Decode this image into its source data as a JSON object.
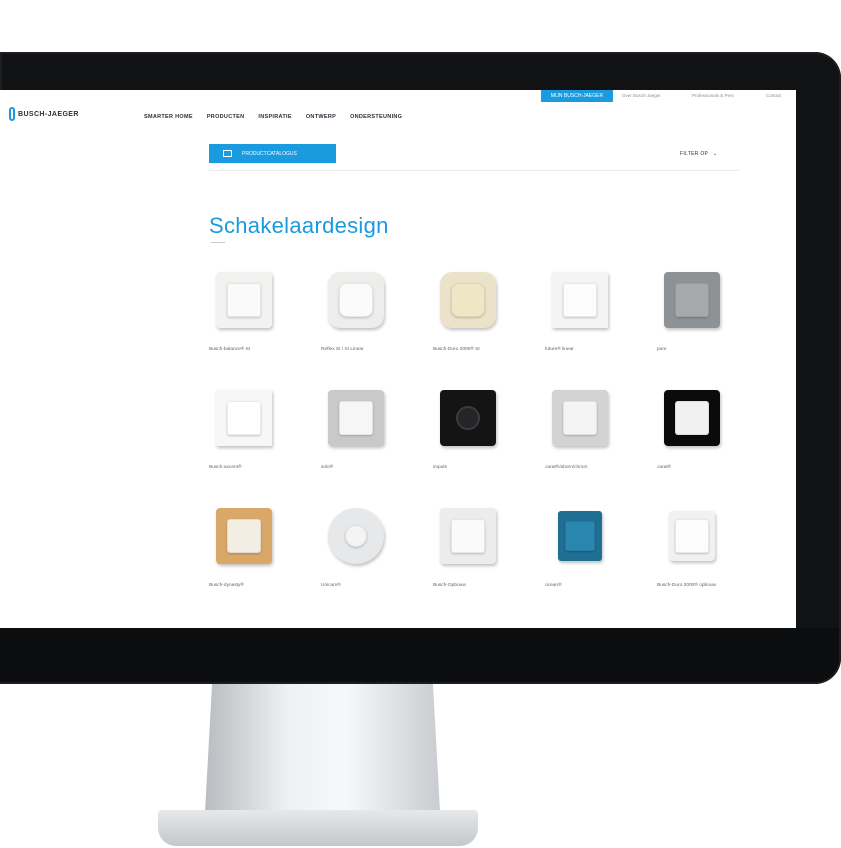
{
  "top": {
    "login_button": "MIJN BUSCH-JAEGER",
    "links": [
      "Over Busch-Jaeger",
      "Professionals & Pers",
      "Contact"
    ]
  },
  "header": {
    "logo": "BUSCH-JAEGER",
    "nav": [
      "SMARTER HOME",
      "PRODUCTEN",
      "INSPIRATIE",
      "ONTWERP",
      "ONDERSTEUNING"
    ],
    "sub_button": "PRODUCTCATALOGUS",
    "filter": "FILTER OP"
  },
  "page_title": "Schakelaardesign",
  "products": [
    {
      "label": "Busch-balance® SI",
      "color": "#f2f2f0",
      "rocker": "#fafafa",
      "shape": "square"
    },
    {
      "label": "Reflex SI / SI Linear",
      "color": "#ededec",
      "rocker": "#fbfbfb",
      "shape": "rounded"
    },
    {
      "label": "Busch-Duro 2000® SI",
      "color": "#ebe3c9",
      "rocker": "#efe6c6",
      "shape": "rounded"
    },
    {
      "label": "future® linear",
      "color": "#f4f4f4",
      "rocker": "#fcfcfc",
      "shape": "flat"
    },
    {
      "label": "pure",
      "color": "#8f9294",
      "rocker": "#a6a9ab",
      "shape": "square"
    },
    {
      "label": "Busch-axcent®",
      "color": "#f7f7f7",
      "rocker": "#ffffff",
      "shape": "flat"
    },
    {
      "label": "solo®",
      "color": "#c8c9cb",
      "rocker": "#f6f6f6",
      "shape": "square"
    },
    {
      "label": "impuls",
      "color": "#141415",
      "rocker": "#242527",
      "shape": "round"
    },
    {
      "label": "carat®/ahorn/chrom",
      "color": "#d2d3d5",
      "rocker": "#f4f4f4",
      "shape": "square"
    },
    {
      "label": "carat®",
      "color": "#0b0b0c",
      "rocker": "#f1f1f1",
      "shape": "square"
    },
    {
      "label": "Busch-dynasty®",
      "color": "#d9a868",
      "rocker": "#f3ede3",
      "shape": "square"
    },
    {
      "label": "Unicum®",
      "color": "#e7e8ea",
      "rocker": "#f4f4f4",
      "shape": "circle"
    },
    {
      "label": "Busch-Opbouw",
      "color": "#ececec",
      "rocker": "#fafafa",
      "shape": "square"
    },
    {
      "label": "ocean®",
      "color": "#1f6f94",
      "rocker": "#2a86ae",
      "shape": "box"
    },
    {
      "label": "Busch-Duro 2000® opbouw",
      "color": "#f1f1f1",
      "rocker": "#fcfcfc",
      "shape": "surface"
    }
  ]
}
